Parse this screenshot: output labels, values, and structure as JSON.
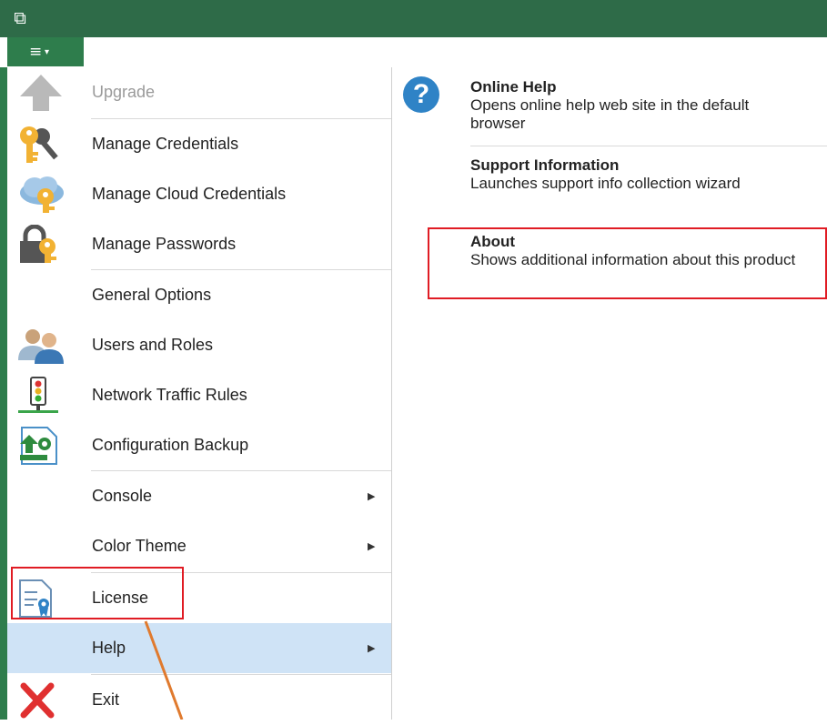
{
  "titlebar": {
    "logo_glyph": "⧉"
  },
  "menubar": {
    "menu_glyph": "≡",
    "menu_arrow": "▾"
  },
  "left_menu": [
    {
      "label": "Upgrade",
      "icon": "upgrade-arrow-icon",
      "disabled": true
    },
    {
      "label": "Manage Credentials",
      "icon": "key-icon"
    },
    {
      "label": "Manage Cloud Credentials",
      "icon": "cloud-key-icon"
    },
    {
      "label": "Manage Passwords",
      "icon": "lock-key-icon"
    },
    {
      "label": "General Options",
      "icon": ""
    },
    {
      "label": "Users and Roles",
      "icon": "users-icon"
    },
    {
      "label": "Network Traffic Rules",
      "icon": "traffic-light-icon"
    },
    {
      "label": "Configuration Backup",
      "icon": "config-backup-icon"
    },
    {
      "label": "Console",
      "icon": "",
      "submenu": true
    },
    {
      "label": "Color Theme",
      "icon": "",
      "submenu": true
    },
    {
      "label": "License",
      "icon": "license-icon"
    },
    {
      "label": "Help",
      "icon": "",
      "submenu": true,
      "active": true
    },
    {
      "label": "Exit",
      "icon": "close-x-icon"
    }
  ],
  "submenu_arrow": "▶",
  "help_panel": {
    "items": [
      {
        "title": "Online Help",
        "desc": "Opens online help web site in the default browser"
      },
      {
        "title": "Support Information",
        "desc": "Launches support info collection wizard"
      },
      {
        "title": "About",
        "desc": "Shows additional information about this product"
      }
    ],
    "help_icon_glyph": "?"
  },
  "colors": {
    "titlebar": "#2e6b48",
    "menu_button": "#2e7d4c",
    "active_item": "#cfe3f6",
    "highlight_box": "#e01c24",
    "annotation_arrow": "#e07a2e"
  }
}
